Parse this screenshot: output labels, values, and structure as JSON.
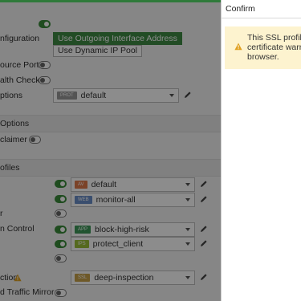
{
  "form": {
    "rows": {
      "configuration": {
        "label": "nfiguration",
        "toggle_on": true
      },
      "ip_pool": {
        "use_outgoing_label": "Use Outgoing Interface Address",
        "use_dynamic_label": "Use Dynamic IP Pool"
      },
      "source_port": {
        "label": "ource Port",
        "toggle_on": false
      },
      "health_check": {
        "label": "alth Check",
        "toggle_on": false
      },
      "options": {
        "label": "ptions",
        "badge": "PROT",
        "value": "default"
      }
    },
    "section_options": "Options",
    "disclaimer": {
      "label": "claimer",
      "toggle_on": false
    },
    "section_profiles": "ofiles",
    "profiles": [
      {
        "badge": "AV",
        "badge_color": "#e07b4a",
        "value": "default",
        "toggle_on": true
      },
      {
        "badge": "WEB",
        "badge_color": "#6b8fc8",
        "value": "monitor-all",
        "toggle_on": true
      }
    ],
    "r_row": {
      "label": "r",
      "toggle_on": false
    },
    "app_control": {
      "label": "n Control",
      "badge": "APP",
      "badge_color": "#3f9a5a",
      "value": "block-high-risk",
      "toggle_on": true
    },
    "ips": {
      "badge": "IPS",
      "badge_color": "#9bbf3a",
      "value": "protect_client",
      "toggle_on": true
    },
    "empty_toggle": {
      "toggle_on": false
    },
    "ssl_inspection": {
      "label": "ction",
      "badge": "SSL",
      "badge_color": "#c9a24a",
      "value": "deep-inspection"
    },
    "traffic_mirror": {
      "label": "d Traffic Mirror",
      "toggle_on": false
    }
  },
  "dialog": {
    "title": "Confirm",
    "message_lines": [
      "This SSL profile u",
      "certificate warni",
      "browser."
    ]
  },
  "colors": {
    "accent_green": "#3e8a44",
    "warning_bg": "#fdf3cf",
    "warning_icon": "#e0a020"
  }
}
